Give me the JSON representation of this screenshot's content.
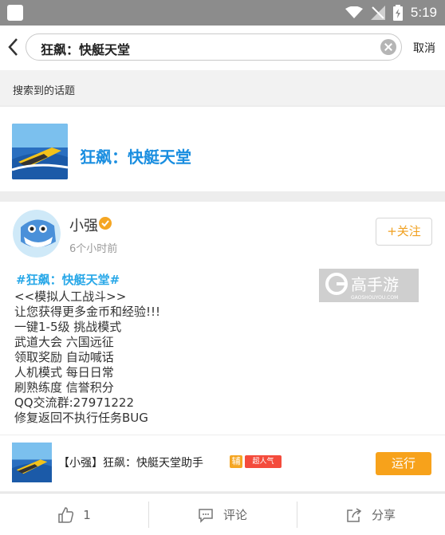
{
  "status_bar": {
    "time": "5:19"
  },
  "search": {
    "query": "狂飙：快艇天堂",
    "cancel_label": "取消"
  },
  "section": {
    "title": "搜索到的话题"
  },
  "topic": {
    "title": "狂飙：快艇天堂"
  },
  "post": {
    "username": "小强",
    "time": "6个小时前",
    "follow_label": "+关注",
    "hashtag": "#狂飙：快艇天堂#",
    "content_lines": [
      "<<模拟人工战斗>>",
      "让您获得更多金币和经验!!!",
      "一键1-5级 挑战模式",
      "武道大会 六国远征",
      "领取奖励 自动喊话",
      "人机模式 每日日常",
      "刷熟练度 信誉积分",
      "QQ交流群:27971222",
      "修复返回不执行任务BUG"
    ],
    "watermark_text": "高手游",
    "watermark_domain": "GAOSHOUYOU.COM"
  },
  "helper": {
    "title": "【小强】狂飙：快艇天堂助手",
    "tag_fu": "辅",
    "tag_hot": "超人气",
    "run_label": "运行"
  },
  "actions": {
    "like_count": "1",
    "comment_label": "评论",
    "share_label": "分享"
  },
  "colors": {
    "accent_blue": "#1a8ee0",
    "accent_orange": "#f7a21b",
    "hashtag_blue": "#29a8e8"
  }
}
